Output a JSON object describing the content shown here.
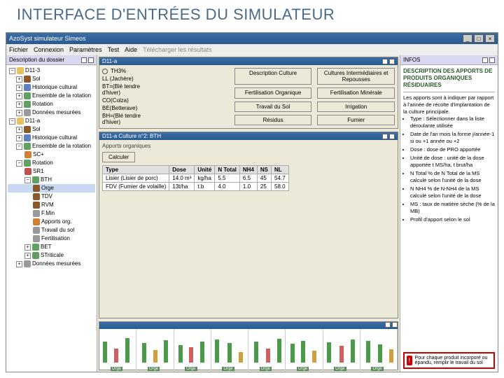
{
  "slide_title": "INTERFACE D'ENTRÉES DU SIMULATEUR",
  "titlebar": {
    "text": "AzoSyst simulateur Simeos"
  },
  "winctrl": {
    "min": "_",
    "max": "□",
    "close": "×"
  },
  "menu": {
    "fichier": "Fichier",
    "connexion": "Connexion",
    "parametres": "Paramètres",
    "test": "Test",
    "aide": "Aide",
    "telecharger": "Télécharger les résultats"
  },
  "sidebar_head": "Description du dossier",
  "tree": {
    "exp_minus": "−",
    "exp_plus": "+",
    "d11_3": "D11-3",
    "sol": "Sol",
    "hist": "Historique cultural",
    "ens": "Ensemble de la rotation",
    "rot": "Rotation",
    "mes": "Données mesurées",
    "d11_a": "D11-a",
    "sc_plus": "SC+",
    "sr1": "SR1",
    "bth": "BTH",
    "orge": "Orge",
    "tdv": "TDV",
    "rvm": "RVM",
    "fmin": "F.Min",
    "apo": "Apports org.",
    "trv": "Travail du sol",
    "ferti": "Fertilisation",
    "bet": "BET",
    "ste": "STriticale",
    "dmes": "Données mesurées"
  },
  "d11a_win": {
    "title": "D11-a",
    "radio_label": "TH3%",
    "crops": {
      "ll": "LL (Jachère)",
      "bt": "BT=(Blé tendre d'hiver)",
      "co": "CO(Colza)",
      "be": "BE(Betterave)",
      "bh": "BH=(Blé tendre d'hiver)"
    },
    "buttons": {
      "desc": "Description Culture",
      "cult_inter": "Cultures Intermédiaires et Repousses",
      "fert_org": "Fertilisation Organique",
      "fert_min": "Fertilisation Minérale",
      "travail": "Travail du Sol",
      "irrig": "Irrigation",
      "residus": "Résidus",
      "fumier": "Fumier"
    }
  },
  "culture_win": {
    "title": "D11-a   Culture n°2: BTH",
    "tab": "Apports organiques",
    "btn": "Calculer",
    "headers": {
      "type": "Type",
      "dose": "Dose",
      "unit": "Unité",
      "ntotal": "N Total",
      "nh4": "NH4",
      "ns": "NS",
      "nl": "NL"
    },
    "rows": [
      {
        "type": "Lisier (Lisier de porc)",
        "dose": "14.0 m³",
        "unit": "kg/ha",
        "ntotal": "5.5",
        "nh4": "6.5",
        "ns": "45",
        "nl": "54.7"
      },
      {
        "type": "FDV (Fumier de volaille)",
        "dose": "13t/ha",
        "unit": "t.b",
        "ntotal": "4.0",
        "nh4": "1.0",
        "ns": "25",
        "nl": "58.0"
      }
    ]
  },
  "timeline": {
    "labels": [
      "Orge",
      "Orge",
      "Orge",
      "Orge",
      "Orge",
      "Orge",
      "Orge",
      "Orge"
    ]
  },
  "info": {
    "head": "INFOS",
    "title": "DESCRIPTION DES APPORTS DE PRODUITS ORGANIQUES RÉSIDUAIRES",
    "intro": "Les apports sont à indiquer par rapport à l'année de récolte d'implantation de la culture principale.",
    "bullets": [
      "Type : Sélectionner dans la liste déroulante utilisée",
      "Date de l'an mois la forme j/année-1 si ou +1 année ou +2",
      "Dose : dose de PRO apportée",
      "Unité de dose : unité de la dose apportée t MS/ha, t brut/ha",
      "N Total % de N Total de la MS calculé selon l'unité de la dose",
      "N NH4 % de N-NH4 de la MS calculé selon l'unité de la dose",
      "MS : taux de matière sèche (% de la MB)",
      "Profil d'apport selon le sol"
    ],
    "warn": "Pour chaque produit incorporé ou épandu, remplir le travail du sol"
  }
}
